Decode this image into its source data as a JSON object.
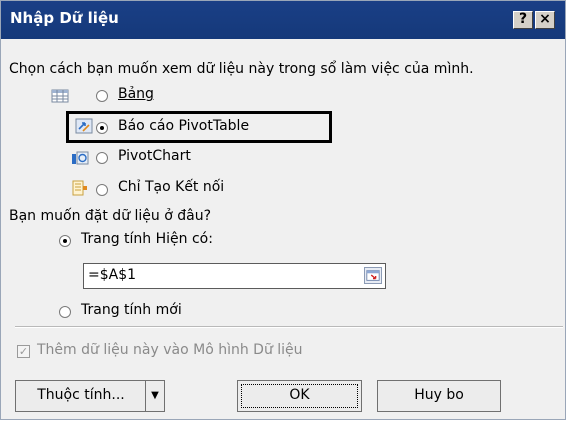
{
  "dialog": {
    "title": "Nhập Dữ liệu",
    "help_label": "?",
    "close_label": "×"
  },
  "view": {
    "prompt": "Chọn cách bạn muốn xem dữ liệu này trong sổ làm việc của mình.",
    "options": [
      {
        "label": "Bảng",
        "selected": false,
        "icon": "table-icon"
      },
      {
        "label": "Báo cáo PivotTable",
        "selected": true,
        "icon": "pivottable-icon"
      },
      {
        "label": "PivotChart",
        "selected": false,
        "icon": "pivotchart-icon"
      },
      {
        "label": "Chỉ Tạo Kết nối",
        "selected": false,
        "icon": "connection-icon"
      }
    ]
  },
  "destination": {
    "prompt": "Bạn muốn đặt dữ liệu ở đâu?",
    "existing_label": "Trang tính Hiện có:",
    "existing_selected": true,
    "range_value": "=$A$1",
    "new_label": "Trang tính mới",
    "new_selected": false
  },
  "data_model": {
    "label": "Thêm dữ liệu này vào Mô hình Dữ liệu",
    "checked": true,
    "enabled": false
  },
  "buttons": {
    "properties": "Thuộc tính...",
    "ok": "OK",
    "cancel": "Huy bo"
  }
}
